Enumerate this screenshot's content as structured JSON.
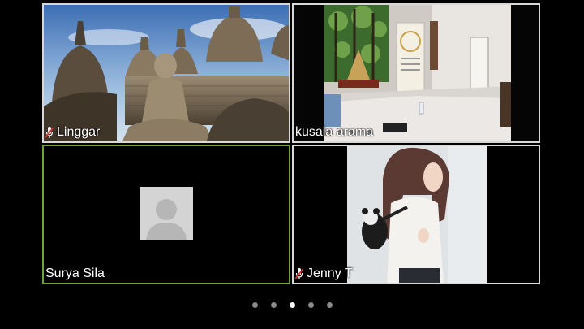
{
  "participants": [
    {
      "name": "Linggar",
      "muted": true,
      "video": "temple-statue",
      "active": false
    },
    {
      "name": "kusala arama",
      "muted": false,
      "video": "meditation-hall",
      "active": false
    },
    {
      "name": "Surya Sila",
      "muted": false,
      "video": "none",
      "active": true
    },
    {
      "name": "Jenny T",
      "muted": true,
      "video": "person-with-backpack",
      "active": false
    }
  ],
  "pager": {
    "count": 5,
    "current": 3
  },
  "colors": {
    "active_border": "#6fa33a",
    "tile_border": "#d8d8d8",
    "background": "#000000",
    "muted_icon": "#e03030"
  }
}
